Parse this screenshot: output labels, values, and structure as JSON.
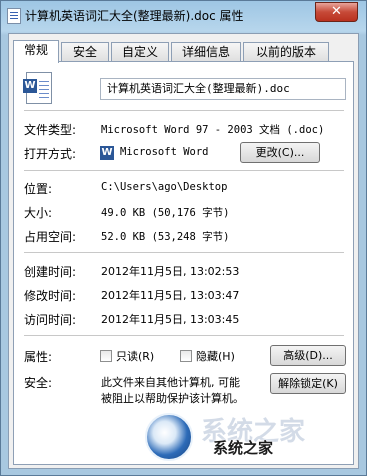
{
  "window": {
    "title": "计算机英语词汇大全(整理最新).doc 属性",
    "close_label": "✕"
  },
  "tabs": [
    {
      "label": "常规",
      "active": true
    },
    {
      "label": "安全",
      "active": false
    },
    {
      "label": "自定义",
      "active": false
    },
    {
      "label": "详细信息",
      "active": false
    },
    {
      "label": "以前的版本",
      "active": false
    }
  ],
  "general": {
    "file_name": "计算机英语词汇大全(整理最新).doc",
    "file_type_label": "文件类型:",
    "file_type_value": "Microsoft Word 97 - 2003 文档 (.doc)",
    "open_with_label": "打开方式:",
    "open_with_value": "Microsoft Word",
    "change_button": "更改(C)...",
    "location_label": "位置:",
    "location_value": "C:\\Users\\ago\\Desktop",
    "size_label": "大小:",
    "size_value": "49.0 KB (50,176 字节)",
    "size_on_disk_label": "占用空间:",
    "size_on_disk_value": "52.0 KB (53,248 字节)",
    "created_label": "创建时间:",
    "created_value": "2012年11月5日, 13:02:53",
    "modified_label": "修改时间:",
    "modified_value": "2012年11月5日, 13:03:47",
    "accessed_label": "访问时间:",
    "accessed_value": "2012年11月5日, 13:03:45",
    "attributes_label": "属性:",
    "readonly_label": "只读(R)",
    "hidden_label": "隐藏(H)",
    "advanced_button": "高级(D)...",
    "security_label": "安全:",
    "security_text_line1": "此文件来自其他计算机, 可能",
    "security_text_line2": "被阻止以帮助保护该计算机。",
    "unblock_button": "解除锁定(K)"
  },
  "watermark": {
    "text": "系统之家"
  }
}
